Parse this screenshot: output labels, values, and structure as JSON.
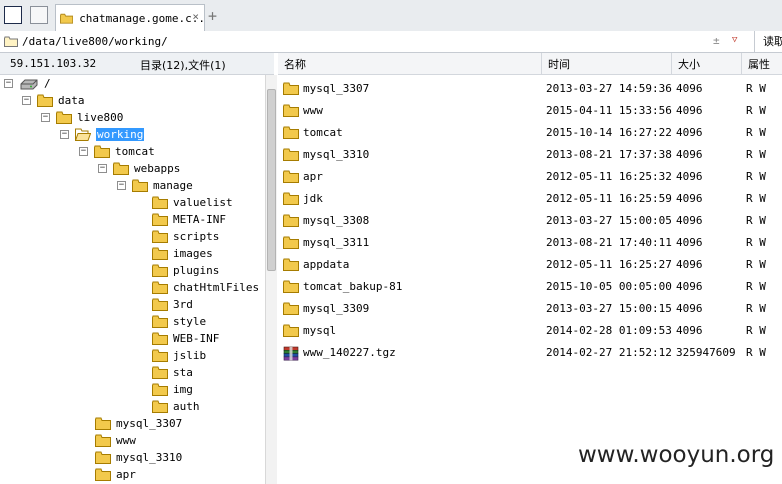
{
  "tab": {
    "title": "chatmanage.gome.c...",
    "close": "×",
    "new": "+"
  },
  "address": {
    "path": "/data/live800/working/",
    "tools": "±",
    "dropdown": "▽",
    "read_label": "读取"
  },
  "left_info": {
    "ip": "59.151.103.32",
    "counts": "目录(12),文件(1)"
  },
  "tree": [
    {
      "label": "/",
      "toggle": "−"
    },
    {
      "label": "data",
      "toggle": "−"
    },
    {
      "label": "live800",
      "toggle": "−"
    },
    {
      "label": "working",
      "toggle": "−"
    },
    {
      "label": "tomcat",
      "toggle": "−"
    },
    {
      "label": "webapps",
      "toggle": "−"
    },
    {
      "label": "manage",
      "toggle": "−"
    },
    {
      "label": "valuelist"
    },
    {
      "label": "META-INF"
    },
    {
      "label": "scripts"
    },
    {
      "label": "images"
    },
    {
      "label": "plugins"
    },
    {
      "label": "chatHtmlFiles"
    },
    {
      "label": "3rd"
    },
    {
      "label": "style"
    },
    {
      "label": "WEB-INF"
    },
    {
      "label": "jslib"
    },
    {
      "label": "sta"
    },
    {
      "label": "img"
    },
    {
      "label": "auth"
    },
    {
      "label": "mysql_3307"
    },
    {
      "label": "www"
    },
    {
      "label": "mysql_3310"
    },
    {
      "label": "apr"
    }
  ],
  "list": {
    "columns": {
      "name": "名称",
      "time": "时间",
      "size": "大小",
      "attr": "属性"
    },
    "rows": [
      {
        "name": "mysql_3307",
        "time": "2013-03-27 14:59:36",
        "size": "4096",
        "attr": "R W",
        "icon": "folder-icon"
      },
      {
        "name": "www",
        "time": "2015-04-11 15:33:56",
        "size": "4096",
        "attr": "R W",
        "icon": "folder-icon"
      },
      {
        "name": "tomcat",
        "time": "2015-10-14 16:27:22",
        "size": "4096",
        "attr": "R W",
        "icon": "folder-icon"
      },
      {
        "name": "mysql_3310",
        "time": "2013-08-21 17:37:38",
        "size": "4096",
        "attr": "R W",
        "icon": "folder-icon"
      },
      {
        "name": "apr",
        "time": "2012-05-11 16:25:32",
        "size": "4096",
        "attr": "R W",
        "icon": "folder-icon"
      },
      {
        "name": "jdk",
        "time": "2012-05-11 16:25:59",
        "size": "4096",
        "attr": "R W",
        "icon": "folder-icon"
      },
      {
        "name": "mysql_3308",
        "time": "2013-03-27 15:00:05",
        "size": "4096",
        "attr": "R W",
        "icon": "folder-icon"
      },
      {
        "name": "mysql_3311",
        "time": "2013-08-21 17:40:11",
        "size": "4096",
        "attr": "R W",
        "icon": "folder-icon"
      },
      {
        "name": "appdata",
        "time": "2012-05-11 16:25:27",
        "size": "4096",
        "attr": "R W",
        "icon": "folder-icon"
      },
      {
        "name": "tomcat_bakup-81",
        "time": "2015-10-05 00:05:00",
        "size": "4096",
        "attr": "R W",
        "icon": "folder-icon"
      },
      {
        "name": "mysql_3309",
        "time": "2013-03-27 15:00:15",
        "size": "4096",
        "attr": "R W",
        "icon": "folder-icon"
      },
      {
        "name": "mysql",
        "time": "2014-02-28 01:09:53",
        "size": "4096",
        "attr": "R W",
        "icon": "folder-icon"
      },
      {
        "name": "www_140227.tgz",
        "time": "2014-02-27 21:52:12",
        "size": "325947609",
        "attr": "R W",
        "icon": "archive-icon"
      }
    ]
  },
  "watermark": "www.wooyun.org",
  "colors": {
    "selection": "#3399ff",
    "folder": "#f2c94c"
  }
}
